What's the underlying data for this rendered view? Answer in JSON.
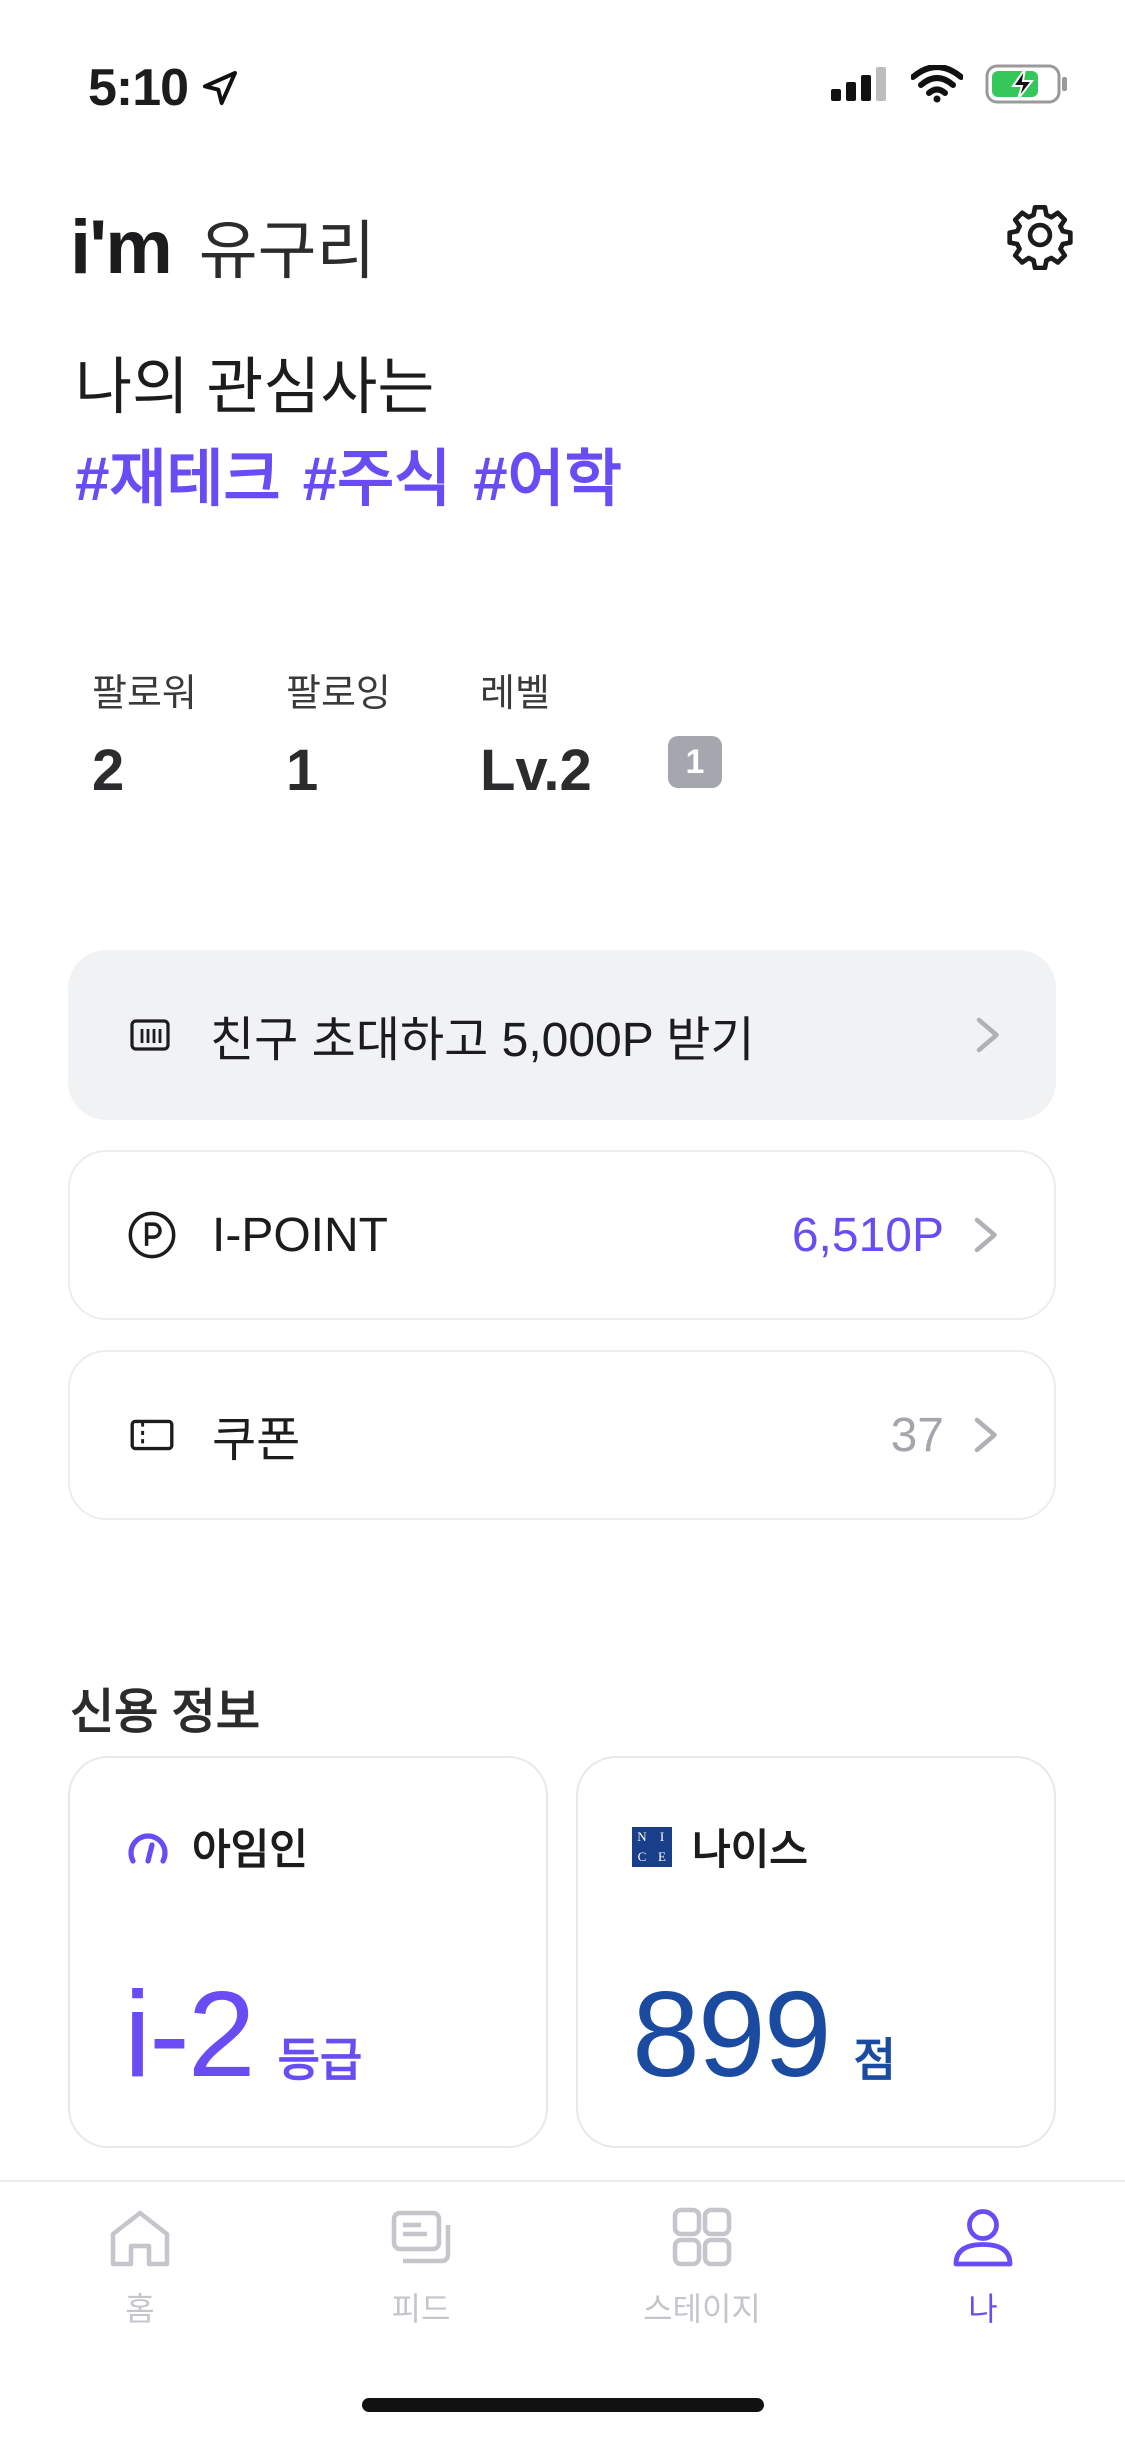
{
  "status_bar": {
    "time": "5:10"
  },
  "header": {
    "prefix": "i'm",
    "username": "유구리"
  },
  "interests": {
    "title": "나의 관심사는",
    "tags": [
      "#재테크",
      "#주식",
      "#어학"
    ]
  },
  "stats": [
    {
      "label": "팔로워",
      "value": "2"
    },
    {
      "label": "팔로잉",
      "value": "1"
    },
    {
      "label": "레벨",
      "value": "Lv.2"
    }
  ],
  "level_badge": "1",
  "menu": {
    "invite": {
      "label": "친구 초대하고 5,000P 받기"
    },
    "ipoint": {
      "label": "I-POINT",
      "value": "6,510P"
    },
    "coupon": {
      "label": "쿠폰",
      "value": "37"
    }
  },
  "credit": {
    "title": "신용 정보",
    "imin": {
      "name": "아임인",
      "value": "i-2",
      "unit": "등급"
    },
    "nice": {
      "name": "나이스",
      "value": "899",
      "unit": "점",
      "logo_text": [
        "N",
        "I",
        "C",
        "E"
      ]
    }
  },
  "tabs": [
    {
      "label": "홈",
      "icon": "home-icon",
      "active": false
    },
    {
      "label": "피드",
      "icon": "feed-icon",
      "active": false
    },
    {
      "label": "스테이지",
      "icon": "grid-icon",
      "active": false
    },
    {
      "label": "나",
      "icon": "person-icon",
      "active": true
    }
  ],
  "colors": {
    "accent": "#6a4cf5",
    "nice_blue": "#1a4ba0",
    "inactive": "#c5c6cc"
  }
}
